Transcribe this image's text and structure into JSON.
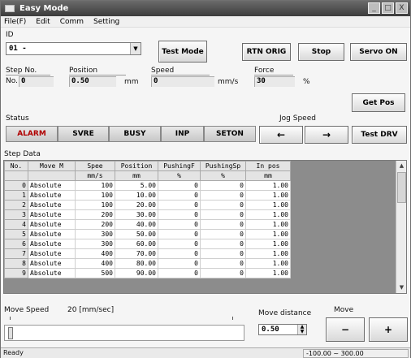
{
  "window": {
    "title": "Easy Mode",
    "buttons": [
      "_",
      "□",
      "X"
    ]
  },
  "menu": [
    "File(F)",
    "Edit",
    "Comm",
    "Setting"
  ],
  "id": {
    "label": "ID",
    "value": "01 -"
  },
  "buttons": {
    "test_mode": "Test Mode",
    "rtn_orig": "RTN ORIG",
    "stop": "Stop",
    "servo_on": "Servo ON",
    "get_pos": "Get Pos",
    "jog_left": "←",
    "jog_right": "→",
    "test_drv": "Test DRV",
    "move_minus": "−",
    "move_plus": "+"
  },
  "readout": {
    "step_label": "Step No.",
    "no_label": "No.",
    "step_value": "0",
    "position_label": "Position",
    "position_value": "0.50",
    "position_unit": "mm",
    "speed_label": "Speed",
    "speed_value": "0",
    "speed_unit": "mm/s",
    "force_label": "Force",
    "force_value": "30",
    "force_unit": "%"
  },
  "status": {
    "label": "Status",
    "items": [
      "ALARM",
      "SVRE",
      "BUSY",
      "INP",
      "SETON"
    ],
    "colors": {
      "red_text": "#b00000",
      "green_text": "#000000"
    }
  },
  "jog_label": "Jog Speed",
  "step_data": {
    "label": "Step Data",
    "headers": [
      "No.",
      "Move M",
      "Spee",
      "Position",
      "PushingF",
      "PushingSp",
      "In pos"
    ],
    "units": [
      "",
      "",
      "mm/s",
      "mm",
      "%",
      "%",
      "mm"
    ],
    "rows": [
      [
        "0",
        "Absolute",
        "100",
        "5.00",
        "0",
        "0",
        "1.00"
      ],
      [
        "1",
        "Absolute",
        "100",
        "10.00",
        "0",
        "0",
        "1.00"
      ],
      [
        "2",
        "Absolute",
        "100",
        "20.00",
        "0",
        "0",
        "1.00"
      ],
      [
        "3",
        "Absolute",
        "200",
        "30.00",
        "0",
        "0",
        "1.00"
      ],
      [
        "4",
        "Absolute",
        "200",
        "40.00",
        "0",
        "0",
        "1.00"
      ],
      [
        "5",
        "Absolute",
        "300",
        "50.00",
        "0",
        "0",
        "1.00"
      ],
      [
        "6",
        "Absolute",
        "300",
        "60.00",
        "0",
        "0",
        "1.00"
      ],
      [
        "7",
        "Absolute",
        "400",
        "70.00",
        "0",
        "0",
        "1.00"
      ],
      [
        "8",
        "Absolute",
        "400",
        "80.00",
        "0",
        "0",
        "1.00"
      ],
      [
        "9",
        "Absolute",
        "500",
        "90.00",
        "0",
        "0",
        "1.00"
      ]
    ]
  },
  "move_speed": {
    "label": "Move Speed",
    "value": "20 [mm/sec]"
  },
  "move_distance": {
    "label": "Move distance",
    "value": "0.50"
  },
  "move_label": "Move",
  "statusbar": {
    "left": "Ready",
    "right": "-100.00 ~ 300.00"
  }
}
